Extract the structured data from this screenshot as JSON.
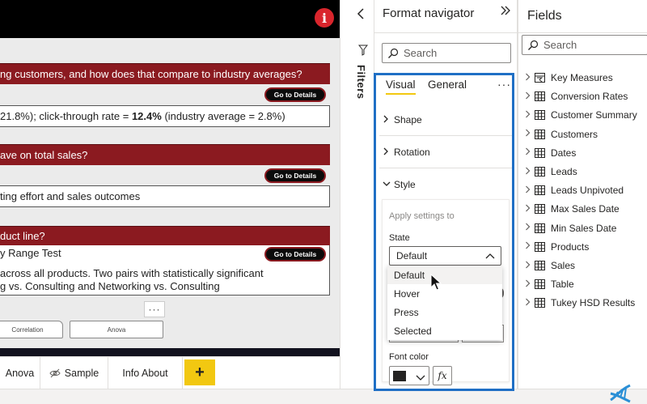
{
  "report": {
    "questions": [
      {
        "header": "ng customers, and how does that compare to industry averages?",
        "button": "Go to Details",
        "body_prefix": "21.8%); click-through rate = ",
        "body_bold": "12.4%",
        "body_suffix": " (industry average = 2.8%)"
      },
      {
        "header": "ave on total sales?",
        "button": "Go to Details",
        "body": "ting effort and sales outcomes"
      },
      {
        "header": "duct line?",
        "subheader": "y Range Test",
        "button": "Go to Details",
        "body_line1": "across all products.  Two pairs with statistically significant",
        "body_line2": "g vs. Consulting and Networking vs. Consulting"
      }
    ],
    "mini_tabs": [
      "Correlation",
      "Anova"
    ],
    "more_dots": "···",
    "info_icon": "i"
  },
  "page_tabs": {
    "tabs": [
      "Anova",
      "Sample",
      "Info About"
    ],
    "add_label": "+"
  },
  "filters": {
    "label": "Filters"
  },
  "format_navigator": {
    "title": "Format navigator",
    "search_placeholder": "Search",
    "tabs": [
      "Visual",
      "General"
    ],
    "more": "···",
    "sections": [
      "Shape",
      "Rotation",
      "Style"
    ],
    "style_card": {
      "apply_settings": "Apply settings to",
      "state_label": "State",
      "state_value": "Default",
      "options": [
        "Default",
        "Hover",
        "Press",
        "Selected"
      ],
      "font_color_label": "Font color",
      "font_color": "#252423",
      "fx": "fx"
    }
  },
  "fields": {
    "title": "Fields",
    "search_placeholder": "Search",
    "items": [
      {
        "label": "Key Measures",
        "icon": "measure-table-icon"
      },
      {
        "label": "Conversion Rates",
        "icon": "table-icon"
      },
      {
        "label": "Customer Summary",
        "icon": "table-icon"
      },
      {
        "label": "Customers",
        "icon": "table-icon"
      },
      {
        "label": "Dates",
        "icon": "table-icon"
      },
      {
        "label": "Leads",
        "icon": "table-icon"
      },
      {
        "label": "Leads Unpivoted",
        "icon": "table-icon"
      },
      {
        "label": "Max Sales Date",
        "icon": "table-icon"
      },
      {
        "label": "Min Sales Date",
        "icon": "table-icon"
      },
      {
        "label": "Products",
        "icon": "table-icon"
      },
      {
        "label": "Sales",
        "icon": "table-icon"
      },
      {
        "label": "Table",
        "icon": "table-icon"
      },
      {
        "label": "Tukey HSD Results",
        "icon": "table-icon"
      }
    ]
  },
  "colors": {
    "header_red": "#8b1a20",
    "highlight_blue": "#1f6fc5",
    "accent_yellow": "#f2c811"
  }
}
